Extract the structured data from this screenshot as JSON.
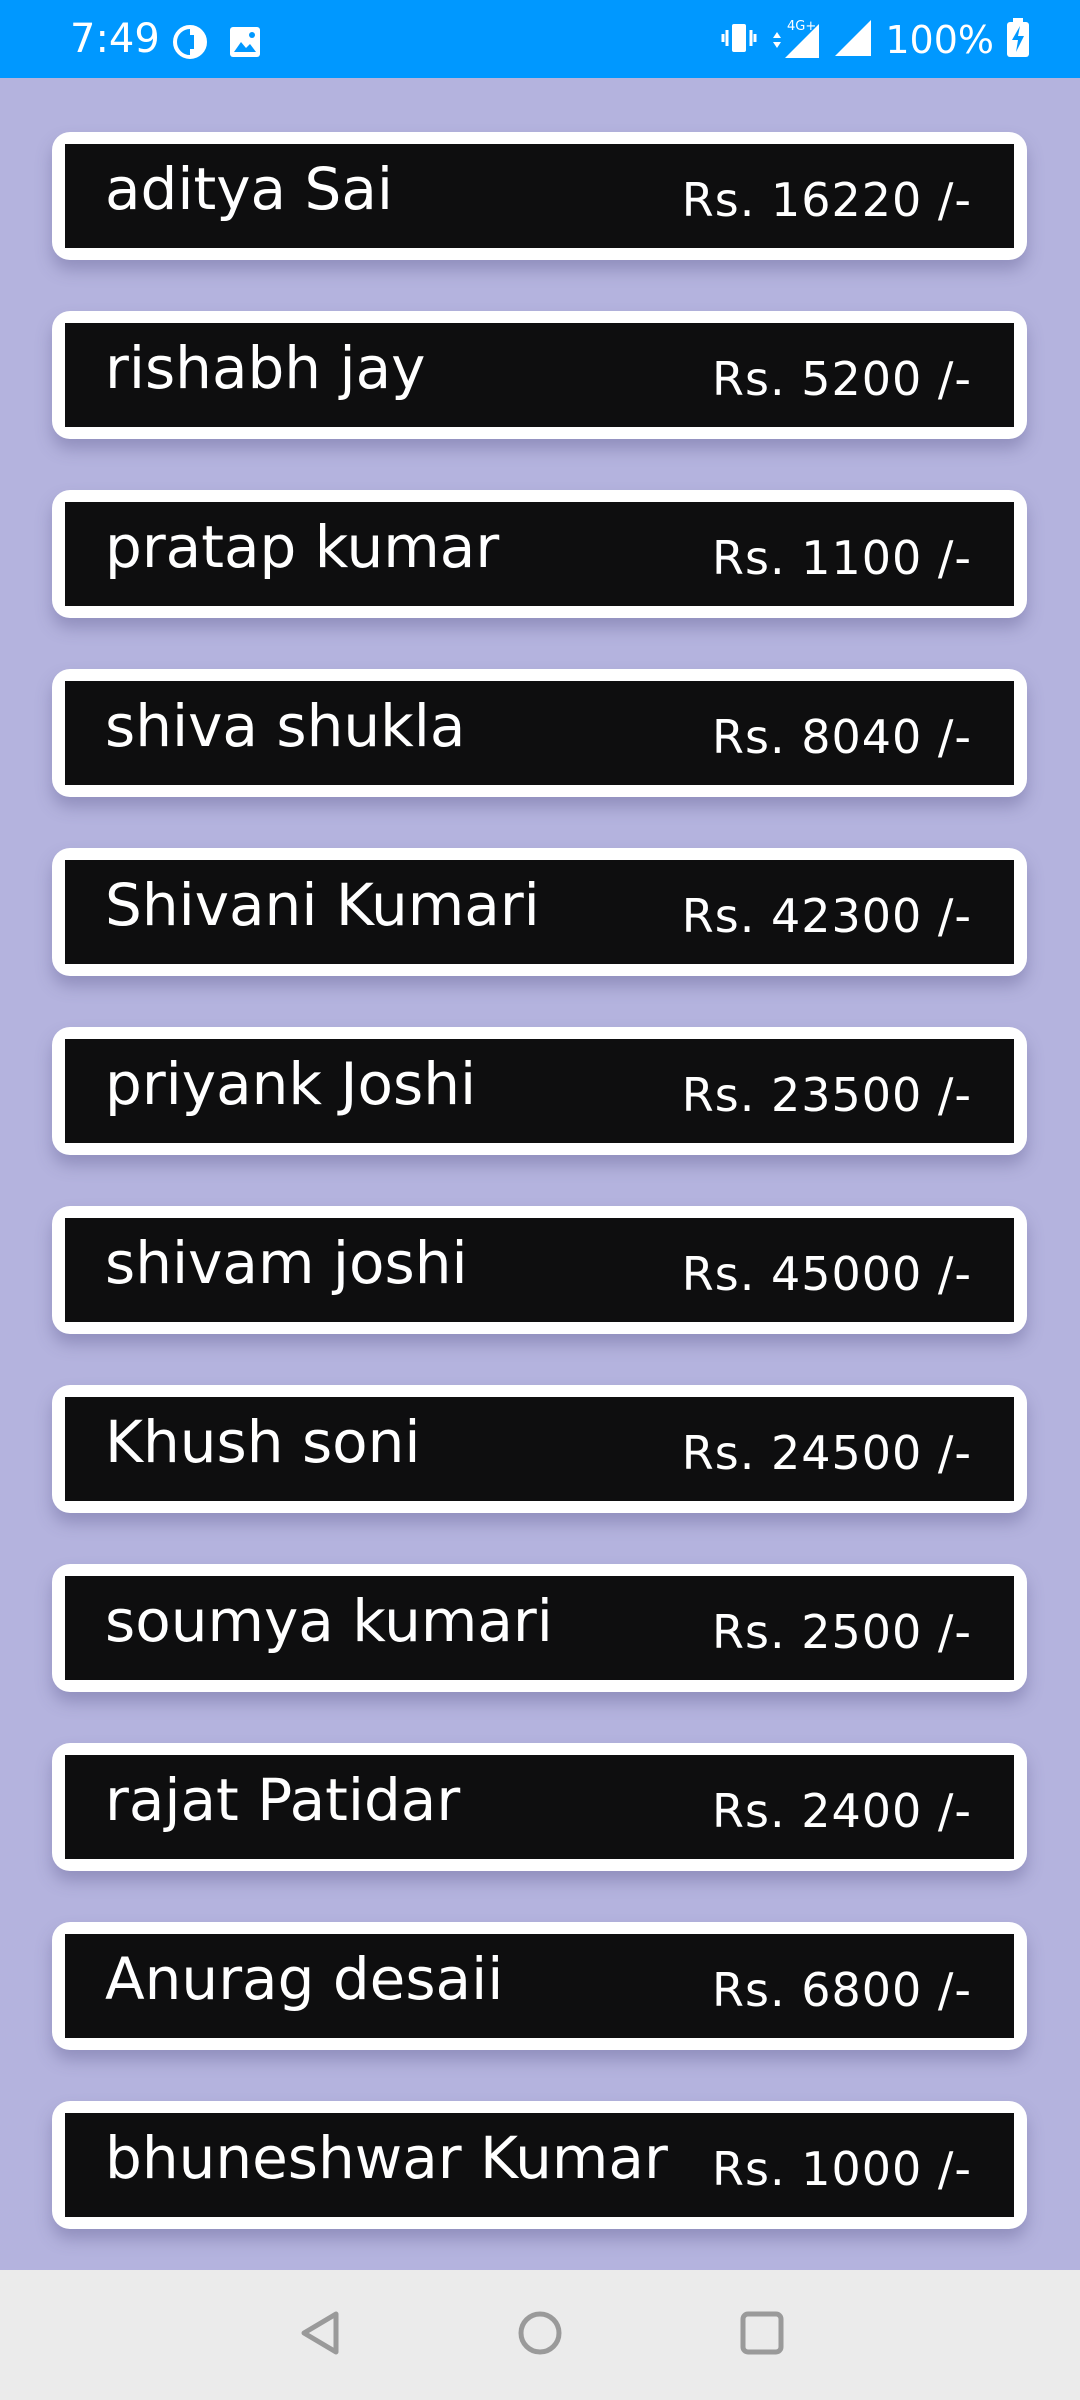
{
  "status_bar": {
    "time": "7:49",
    "battery": "100%",
    "icons_left": [
      "data-saver-icon",
      "image-icon"
    ],
    "icons_right": [
      "vibrate-icon",
      "mobile-data-4g-icon",
      "signal-icon",
      "battery-charging-icon"
    ]
  },
  "customers": [
    {
      "name": "aditya Sai",
      "amount": "Rs. 16220 /-"
    },
    {
      "name": "rishabh jay",
      "amount": "Rs. 5200 /-"
    },
    {
      "name": "pratap kumar",
      "amount": "Rs. 1100 /-"
    },
    {
      "name": "shiva shukla",
      "amount": "Rs. 8040 /-"
    },
    {
      "name": "Shivani Kumari",
      "amount": "Rs. 42300 /-"
    },
    {
      "name": "priyank Joshi",
      "amount": "Rs. 23500 /-"
    },
    {
      "name": "shivam joshi",
      "amount": "Rs. 45000 /-"
    },
    {
      "name": "Khush soni",
      "amount": "Rs. 24500 /-"
    },
    {
      "name": "soumya kumari",
      "amount": "Rs. 2500 /-"
    },
    {
      "name": "rajat Patidar",
      "amount": "Rs. 2400 /-"
    },
    {
      "name": "Anurag desaii",
      "amount": "Rs. 6800 /-"
    },
    {
      "name": "bhuneshwar Kumar",
      "amount": "Rs. 1000 /-"
    }
  ],
  "nav_bar": {
    "buttons": [
      "back-icon",
      "home-icon",
      "recents-icon"
    ]
  },
  "colors": {
    "status_bar": "#0098ff",
    "background": "#b4b3de",
    "card_border": "#ffffff",
    "card_fill": "#0e0e0f",
    "nav_bar": "#ebebeb"
  }
}
